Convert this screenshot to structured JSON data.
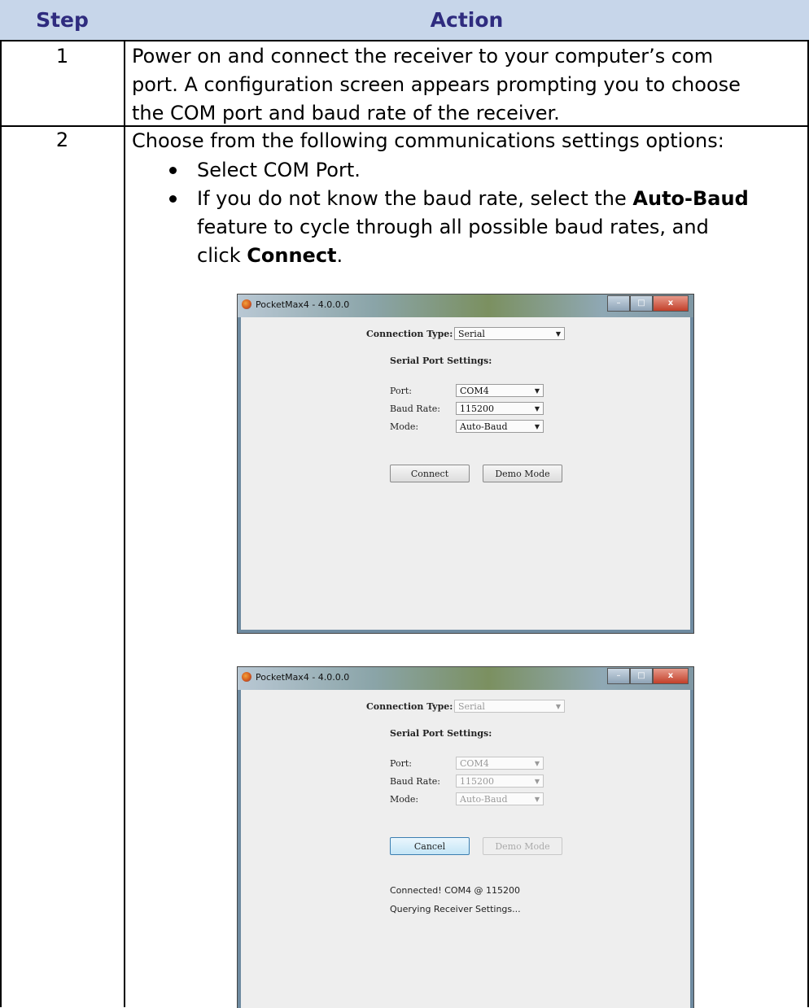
{
  "table": {
    "headers": {
      "step": "Step",
      "action": "Action"
    },
    "rows": [
      {
        "step": "1",
        "lines": [
          "Power on and connect the receiver to your computer’s com",
          "port. A configuration screen appears prompting you to choose",
          "the COM port and baud rate of the receiver."
        ]
      },
      {
        "step": "2",
        "intro": "Choose from the following communications settings options:",
        "bullets": {
          "b1": "Select COM Port.",
          "b2_a": "If you do not know the baud rate, select the ",
          "b2_bold1": "Auto-Baud",
          "b2_b": "feature to cycle through all possible baud rates, and",
          "b2_c": "click ",
          "b2_bold2": "Connect",
          "b2_d": "."
        }
      }
    ]
  },
  "window1": {
    "title": "PocketMax4 - 4.0.0.0",
    "controls": {
      "minimize": "–",
      "maximize": "□",
      "close": "x"
    },
    "connection_type_label": "Connection Type:",
    "connection_type_value": "Serial",
    "serial_settings_label": "Serial Port Settings:",
    "port_label": "Port:",
    "port_value": "COM4",
    "baud_label": "Baud Rate:",
    "baud_value": "115200",
    "mode_label": "Mode:",
    "mode_value": "Auto-Baud",
    "connect_button": "Connect",
    "demo_button": "Demo Mode"
  },
  "window2": {
    "title": "PocketMax4 - 4.0.0.0",
    "controls": {
      "minimize": "–",
      "maximize": "□",
      "close": "x"
    },
    "connection_type_label": "Connection Type:",
    "connection_type_value": "Serial",
    "serial_settings_label": "Serial Port Settings:",
    "port_label": "Port:",
    "port_value": "COM4",
    "baud_label": "Baud Rate:",
    "baud_value": "115200",
    "mode_label": "Mode:",
    "mode_value": "Auto-Baud",
    "cancel_button": "Cancel",
    "demo_button": "Demo Mode",
    "status_connected": "Connected! COM4 @ 115200",
    "status_querying": "Querying Receiver Settings..."
  },
  "colors": {
    "header_bg": "#c7d6ea",
    "header_text": "#2f2c7f"
  },
  "icons": {
    "app": "pocketmax-app-icon",
    "dropdown": "chevron-down-icon"
  }
}
